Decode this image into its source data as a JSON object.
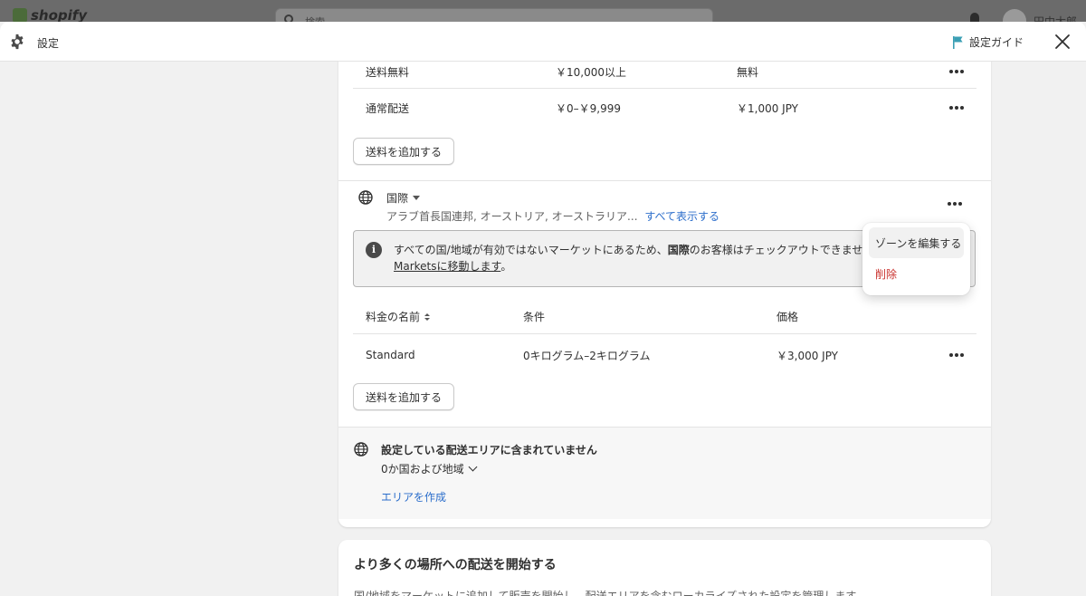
{
  "admin_bar": {
    "logo_text": "shopify",
    "search_placeholder": "検索",
    "user_name": "田中太郎"
  },
  "settings_header": {
    "title": "設定",
    "guide_label": "設定ガイド"
  },
  "domestic_rates": [
    {
      "name": "送料無料",
      "condition": "￥10,000以上",
      "price": "無料"
    },
    {
      "name": "通常配送",
      "condition": "￥0–￥9,999",
      "price": "￥1,000 JPY"
    }
  ],
  "add_rate_label": "送料を追加する",
  "international_zone": {
    "name": "国際",
    "countries": "アラブ首長国連邦, オーストリア, オーストラリア...",
    "show_all_link": "すべて表示する",
    "banner": {
      "text_before": "すべての国/地域が有効ではないマーケットにあるため、",
      "text_bold": "国際",
      "text_after": "のお客様はチェックアウトできません。",
      "link_text": "Marketsに移動します",
      "text_end": "。"
    },
    "table_headers": {
      "name": "料金の名前",
      "condition": "条件",
      "price": "価格"
    },
    "rates": [
      {
        "name": "Standard",
        "condition": "0キログラム–2キログラム",
        "price": "￥3,000 JPY"
      }
    ]
  },
  "popover": {
    "edit_zone": "ゾーンを編集する",
    "delete": "削除"
  },
  "not_included": {
    "title": "設定している配送エリアに含まれていません",
    "count": "0か国および地域",
    "create_link": "エリアを作成"
  },
  "start_shipping": {
    "title": "より多くの場所への配送を開始する",
    "text": "国/地域をマーケットに追加して販売を開始し、配送エリアを含むローカライズされた設定を管理します。"
  },
  "colors": {
    "link": "#2c6ecb",
    "danger": "#c9302c",
    "guide_flag": "#3b9fb4"
  }
}
